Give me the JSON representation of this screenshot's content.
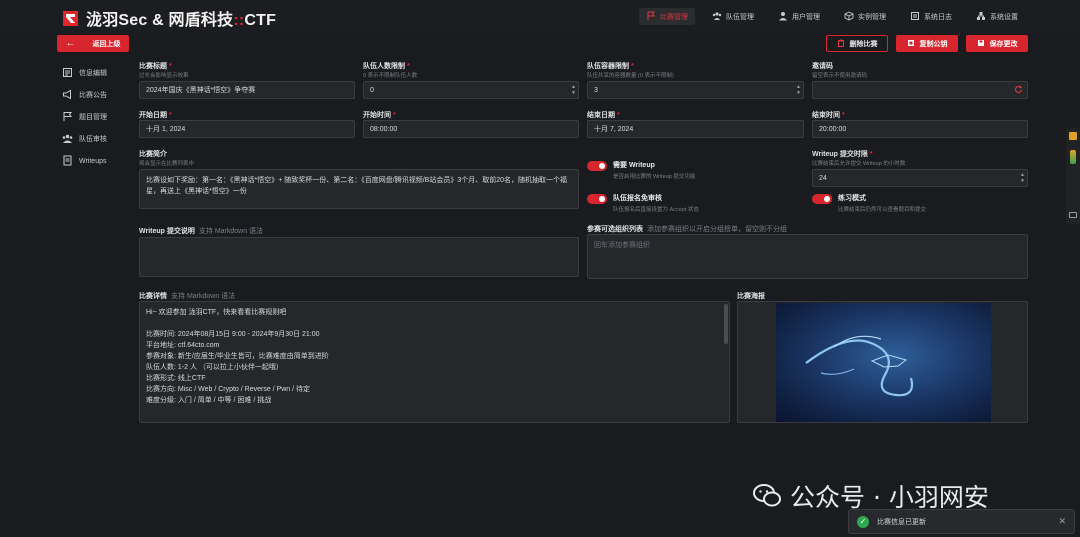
{
  "brand": {
    "title_main": "泷羽Sec & 网盾科技",
    "title_sep": "::",
    "title_ctf": "CTF"
  },
  "nav": [
    {
      "label": "比赛管理",
      "icon": "flag-icon",
      "active": true
    },
    {
      "label": "队伍管理",
      "icon": "team-icon"
    },
    {
      "label": "用户管理",
      "icon": "user-icon"
    },
    {
      "label": "实例管理",
      "icon": "cube-icon"
    },
    {
      "label": "系统日志",
      "icon": "log-icon"
    },
    {
      "label": "系统设置",
      "icon": "settings-icon"
    }
  ],
  "actions": {
    "back": "返回上级",
    "delete": "删除比赛",
    "copy": "复制公钥",
    "save": "保存更改"
  },
  "sidebar": [
    {
      "label": "信息编辑",
      "icon": "edit-icon"
    },
    {
      "label": "比赛公告",
      "icon": "announce-icon"
    },
    {
      "label": "题目管理",
      "icon": "flag-icon"
    },
    {
      "label": "队伍审核",
      "icon": "team-icon"
    },
    {
      "label": "Writeups",
      "icon": "writeup-icon"
    }
  ],
  "form": {
    "title": {
      "label": "比赛标题",
      "hint": "过长会影响显示效果",
      "value": "2024年国庆《黑神话*悟空》争夺赛"
    },
    "team_limit": {
      "label": "队伍人数限制",
      "hint": "0 表示不限制队伍人数",
      "value": "0"
    },
    "container_limit": {
      "label": "队伍容器限制",
      "hint": "队伍共享的容器数量 (0 表示不限制)",
      "value": "3"
    },
    "invite_code": {
      "label": "邀请码",
      "hint": "留空表示不使用邀请码",
      "value": ""
    },
    "start_date": {
      "label": "开始日期",
      "value": "十月 1, 2024"
    },
    "start_time": {
      "label": "开始时间",
      "value": "08:00:00"
    },
    "end_date": {
      "label": "结束日期",
      "value": "十月 7, 2024"
    },
    "end_time": {
      "label": "结束时间",
      "value": "20:00:00"
    },
    "summary": {
      "label": "比赛简介",
      "hint": "将会显示在比赛列表中",
      "value": "比赛设如下奖励：第一名：《黑神话*悟空》+ 随致奖杯一份、第二名：《百度网盘/腾讯视频/B站会员》3个月、取前20名，随机抽取一个福星，再送上《黑神话*悟空》一份"
    },
    "need_writeup": {
      "title": "需要 Writeup",
      "desc": "是否启用比赛的 Writeup 提交功能"
    },
    "auto_accept": {
      "title": "队伍报名免审核",
      "desc": "队伍报名后直接设置为 Accept 状态"
    },
    "writeup_deadline": {
      "label": "Writeup 提交时限",
      "hint": "比赛结束后允许提交 Writeup 的小时数",
      "value": "24"
    },
    "practice_mode": {
      "title": "练习模式",
      "desc": "比赛结束后仍然可以查看题目和提交"
    },
    "writeup_note": {
      "label": "Writeup 提交说明",
      "sub": "支持 Markdown 语法",
      "value": ""
    },
    "org_list": {
      "label": "参赛可选组织列表",
      "sub": "添加参赛组织以开启分组榜单，留空则不分组",
      "placeholder": "回车添加参赛组织"
    },
    "detail": {
      "label": "比赛详情",
      "sub": "支持 Markdown 语法",
      "lines": [
        "Hi~ 欢迎参加 泷羽CTF，快来看看比赛规则吧",
        "",
        "比赛时间: 2024年08月15日 9:00 - 2024年9月30日 21:00",
        "平台地址: ctf.64cto.com",
        "参赛对象: 新生/应届生/毕业生皆可，比赛难度由简单到进阶",
        "队伍人数: 1-2 人 （可以拉上小伙伴一起哦）",
        "比赛形式: 线上CTF",
        "比赛方向: Misc / Web / Crypto / Reverse / Pwn / 待定",
        "难度分级: 入门 / 简单 / 中等 / 困难 / 挑战"
      ]
    },
    "poster": {
      "label": "比赛海报"
    }
  },
  "watermark": "公众号 · 小羽网安",
  "toast": "比赛信息已更新",
  "colors": {
    "accent": "#d7262e",
    "bg": "#1a1b1e",
    "success": "#2fa84f"
  }
}
